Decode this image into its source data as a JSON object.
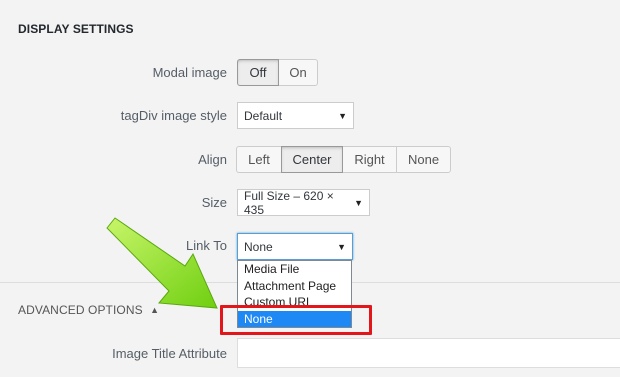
{
  "display_settings": {
    "title": "DISPLAY SETTINGS",
    "modal_image": {
      "label": "Modal image",
      "options": [
        "Off",
        "On"
      ],
      "selected": "Off"
    },
    "tagdiv_style": {
      "label": "tagDiv image style",
      "value": "Default"
    },
    "align": {
      "label": "Align",
      "options": [
        "Left",
        "Center",
        "Right",
        "None"
      ],
      "selected": "Center"
    },
    "size": {
      "label": "Size",
      "value": "Full Size – 620 × 435"
    },
    "link_to": {
      "label": "Link To",
      "value": "None",
      "options": [
        "Media File",
        "Attachment Page",
        "Custom URL",
        "None"
      ],
      "highlighted": "None"
    }
  },
  "advanced_options": {
    "title": "ADVANCED OPTIONS",
    "toggle_icon": "triangle-up-icon",
    "image_title": {
      "label": "Image Title Attribute",
      "value": ""
    }
  },
  "annotations": {
    "arrow_color": "#7ed321",
    "highlight_color": "#e3161b"
  }
}
